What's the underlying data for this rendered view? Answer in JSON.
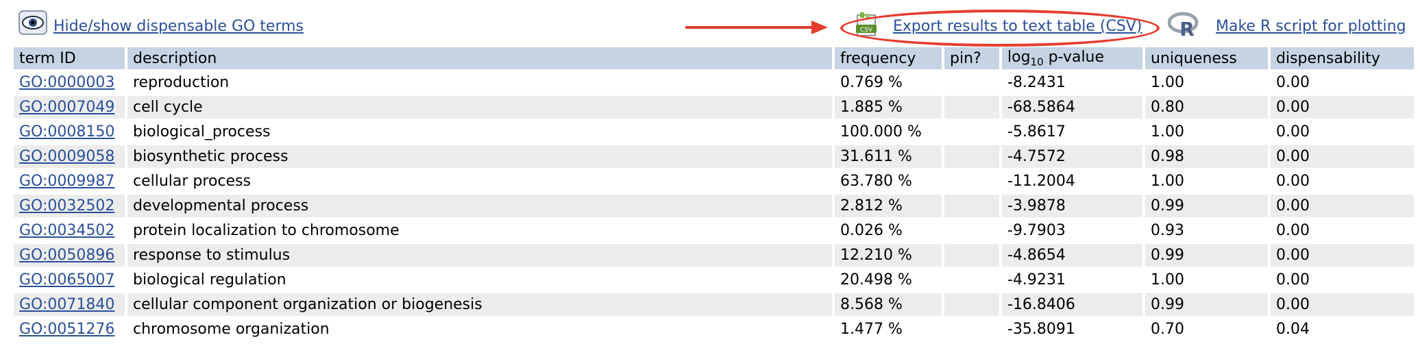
{
  "toolbar": {
    "hide_show_label": "Hide/show dispensable GO terms",
    "export_label": "Export results to text table (CSV)",
    "r_script_label": "Make R script for plotting",
    "csv_icon_text": "CSV",
    "r_icon_text": "R"
  },
  "table": {
    "headers": {
      "term_id": "term ID",
      "description": "description",
      "frequency": "frequency",
      "pin": "pin?",
      "log_prefix": "log",
      "log_sub": "10",
      "log_suffix": " p-value",
      "uniqueness": "uniqueness",
      "dispensability": "dispensability"
    },
    "rows": [
      {
        "id": "GO:0000003",
        "description": "reproduction",
        "frequency": "0.769 %",
        "pin": "",
        "pvalue": "-8.2431",
        "uniqueness": "1.00",
        "dispensability": "0.00"
      },
      {
        "id": "GO:0007049",
        "description": "cell cycle",
        "frequency": "1.885 %",
        "pin": "",
        "pvalue": "-68.5864",
        "uniqueness": "0.80",
        "dispensability": "0.00"
      },
      {
        "id": "GO:0008150",
        "description": "biological_process",
        "frequency": "100.000 %",
        "pin": "",
        "pvalue": "-5.8617",
        "uniqueness": "1.00",
        "dispensability": "0.00"
      },
      {
        "id": "GO:0009058",
        "description": "biosynthetic process",
        "frequency": "31.611 %",
        "pin": "",
        "pvalue": "-4.7572",
        "uniqueness": "0.98",
        "dispensability": "0.00"
      },
      {
        "id": "GO:0009987",
        "description": "cellular process",
        "frequency": "63.780 %",
        "pin": "",
        "pvalue": "-11.2004",
        "uniqueness": "1.00",
        "dispensability": "0.00"
      },
      {
        "id": "GO:0032502",
        "description": "developmental process",
        "frequency": "2.812 %",
        "pin": "",
        "pvalue": "-3.9878",
        "uniqueness": "0.99",
        "dispensability": "0.00"
      },
      {
        "id": "GO:0034502",
        "description": "protein localization to chromosome",
        "frequency": "0.026 %",
        "pin": "",
        "pvalue": "-9.7903",
        "uniqueness": "0.93",
        "dispensability": "0.00"
      },
      {
        "id": "GO:0050896",
        "description": "response to stimulus",
        "frequency": "12.210 %",
        "pin": "",
        "pvalue": "-4.8654",
        "uniqueness": "0.99",
        "dispensability": "0.00"
      },
      {
        "id": "GO:0065007",
        "description": "biological regulation",
        "frequency": "20.498 %",
        "pin": "",
        "pvalue": "-4.9231",
        "uniqueness": "1.00",
        "dispensability": "0.00"
      },
      {
        "id": "GO:0071840",
        "description": "cellular component organization or biogenesis",
        "frequency": "8.568 %",
        "pin": "",
        "pvalue": "-16.8406",
        "uniqueness": "0.99",
        "dispensability": "0.00"
      },
      {
        "id": "GO:0051276",
        "description": "chromosome organization",
        "frequency": "1.477 %",
        "pin": "",
        "pvalue": "-35.8091",
        "uniqueness": "0.70",
        "dispensability": "0.04"
      }
    ]
  },
  "colors": {
    "link": "#2a4f9a",
    "header_bg": "#c5d3e3",
    "row_alt": "#ececec",
    "annotation_red": "#e53d2f"
  },
  "icons": [
    "eye-icon",
    "csv-file-icon",
    "r-logo-icon",
    "arrow-annotation"
  ]
}
